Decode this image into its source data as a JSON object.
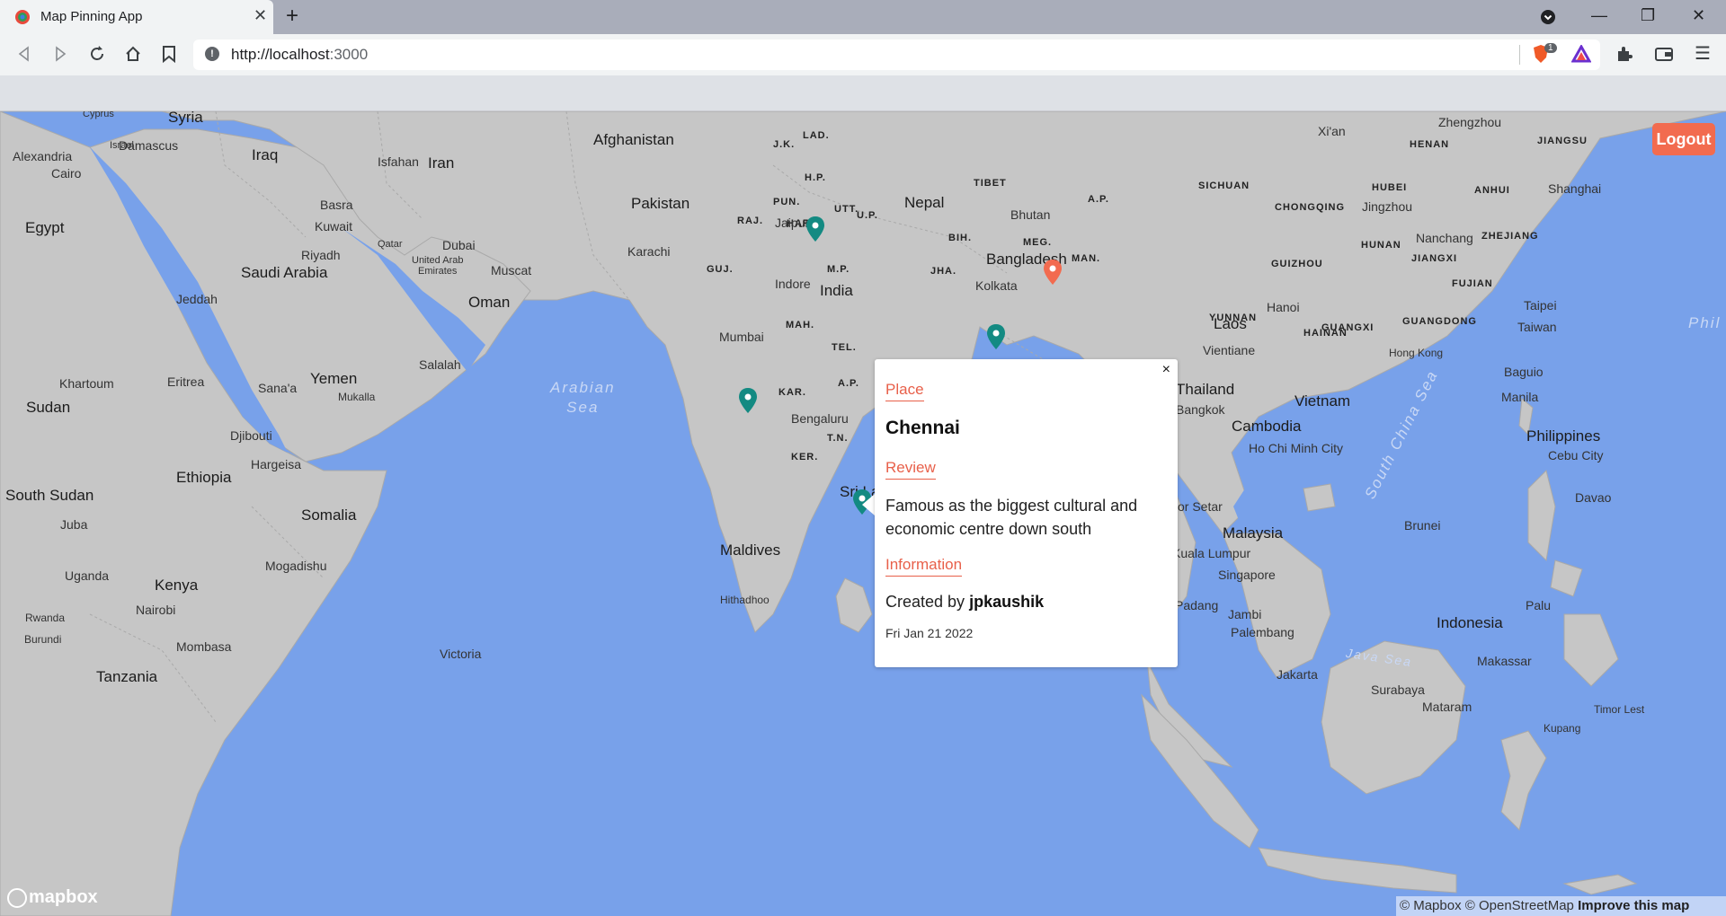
{
  "browser": {
    "tab_title": "Map Pinning App",
    "url_host": "http://localhost",
    "url_port": ":3000",
    "extension_badge": "1"
  },
  "map": {
    "labels": {
      "cyprus": "Cyprus",
      "syria": "Syria",
      "damascus": "Damascus",
      "iraq": "Iraq",
      "isfahan": "Isfahan",
      "iran": "Iran",
      "afghanistan": "Afghanistan",
      "jk": "J.K.",
      "lad": "LAD.",
      "hp": "H.P.",
      "pun": "PUN.",
      "utt": "UTT.",
      "har": "HAR.",
      "tibet": "TIBET",
      "xian": "Xi'an",
      "zhengzhou": "Zhengzhou",
      "henan": "HENAN",
      "jiangsu": "JIANGSU",
      "sichuan": "SICHUAN",
      "hubei": "HUBEI",
      "anhui": "ANHUI",
      "shanghai": "Shanghai",
      "chongqing": "CHONGQING",
      "jingzhou": "Jingzhou",
      "nanchang": "Nanchang",
      "zhejiang": "ZHEJIANG",
      "hunan": "HUNAN",
      "guizhou": "GUIZHOU",
      "jiangxi": "JIANGXI",
      "fujian": "FUJIAN",
      "taipei": "Taipei",
      "taiwan": "Taiwan",
      "yunnan": "YUNNAN",
      "guangxi": "GUANGXI",
      "guangdong": "GUANGDONG",
      "hongkong": "Hong Kong",
      "alexandria": "Alexandria",
      "israel": "Israel",
      "cairo": "Cairo",
      "basra": "Basra",
      "kuwait": "Kuwait",
      "egypt": "Egypt",
      "pakistan": "Pakistan",
      "nepal": "Nepal",
      "up": "U.P.",
      "bhutan": "Bhutan",
      "ap_ne": "A.P.",
      "raj": "RAJ.",
      "jaipur": "Jaipur",
      "bih": "BIH.",
      "meg": "MEG.",
      "man": "MAN.",
      "riyadh": "Riyadh",
      "qatar": "Qatar",
      "dubai": "Dubai",
      "karachi": "Karachi",
      "bangladesh": "Bangladesh",
      "uae": "United Arab\nEmirates",
      "muscat": "Muscat",
      "guj": "GUJ.",
      "mp": "M.P.",
      "jha": "JHA.",
      "saudi": "Saudi Arabia",
      "indore": "Indore",
      "india": "India",
      "kolkata": "Kolkata",
      "jeddah": "Jeddah",
      "oman": "Oman",
      "mah": "MAH.",
      "mumbai": "Mumbai",
      "hanoi": "Hanoi",
      "laos": "Laos",
      "hainan": "HAINAN",
      "tel": "TEL.",
      "vientiane": "Vientiane",
      "salalah": "Salalah",
      "khartoum": "Khartoum",
      "eritrea": "Eritrea",
      "yemen": "Yemen",
      "sanaa": "Sana'a",
      "mukalla": "Mukalla",
      "ap": "A.P.",
      "kar": "KAR.",
      "thailand": "Thailand",
      "bangkok": "Bangkok",
      "vietnam": "Vietnam",
      "baguio": "Baguio",
      "manila": "Manila",
      "sudan": "Sudan",
      "bengaluru": "Bengaluru",
      "cambodia": "Cambodia",
      "djibouti": "Djibouti",
      "tn": "T.N.",
      "hcmc": "Ho Chi Minh City",
      "philippines": "Philippines",
      "hargeisa": "Hargeisa",
      "cebu": "Cebu City",
      "ethiopia": "Ethiopia",
      "ker": "KER.",
      "srilanka": "Sri La",
      "davao": "Davao",
      "south_sudan": "South Sudan",
      "somalia": "Somalia",
      "orsetar": "or Setar",
      "juba": "Juba",
      "malaysia": "Malaysia",
      "brunei": "Brunei",
      "kl": "Kuala Lumpur",
      "maldives": "Maldives",
      "mogadishu": "Mogadishu",
      "uganda": "Uganda",
      "singapore": "Singapore",
      "kenya": "Kenya",
      "hithadhoo": "Hithadhoo",
      "padang": "Padang",
      "palu": "Palu",
      "nairobi": "Nairobi",
      "jambi": "Jambi",
      "rwanda": "Rwanda",
      "indonesia": "Indonesia",
      "palembang": "Palembang",
      "burundi": "Burundi",
      "mombasa": "Mombasa",
      "victoria": "Victoria",
      "makassar": "Makassar",
      "jakarta": "Jakarta",
      "tanzania": "Tanzania",
      "surabaya": "Surabaya",
      "mataram": "Mataram",
      "timorleste": "Timor Lest",
      "kupang": "Kupang",
      "phil": "Phil",
      "arabian_sea": "Arabian\nSea",
      "south_china_sea": "South China Sea",
      "java_sea": "Java Sea"
    }
  },
  "popup": {
    "place_label": "Place",
    "place": "Chennai",
    "review_label": "Review",
    "review": "Famous as the biggest cultural and economic centre down south",
    "info_label": "Information",
    "created_prefix": "Created by",
    "username": "jpkaushik",
    "date": "Fri Jan 21 2022",
    "close": "×"
  },
  "logout_label": "Logout",
  "mapbox_logo": "mapbox",
  "attribution": {
    "mapbox": "© Mapbox",
    "osm": "© OpenStreetMap",
    "improve": "Improve this map"
  },
  "colors": {
    "water": "#78a1ea",
    "land": "#c6c6c6",
    "accent": "#f26b4f",
    "pin_teal": "#138a82",
    "pin_orange": "#f26b4f"
  }
}
